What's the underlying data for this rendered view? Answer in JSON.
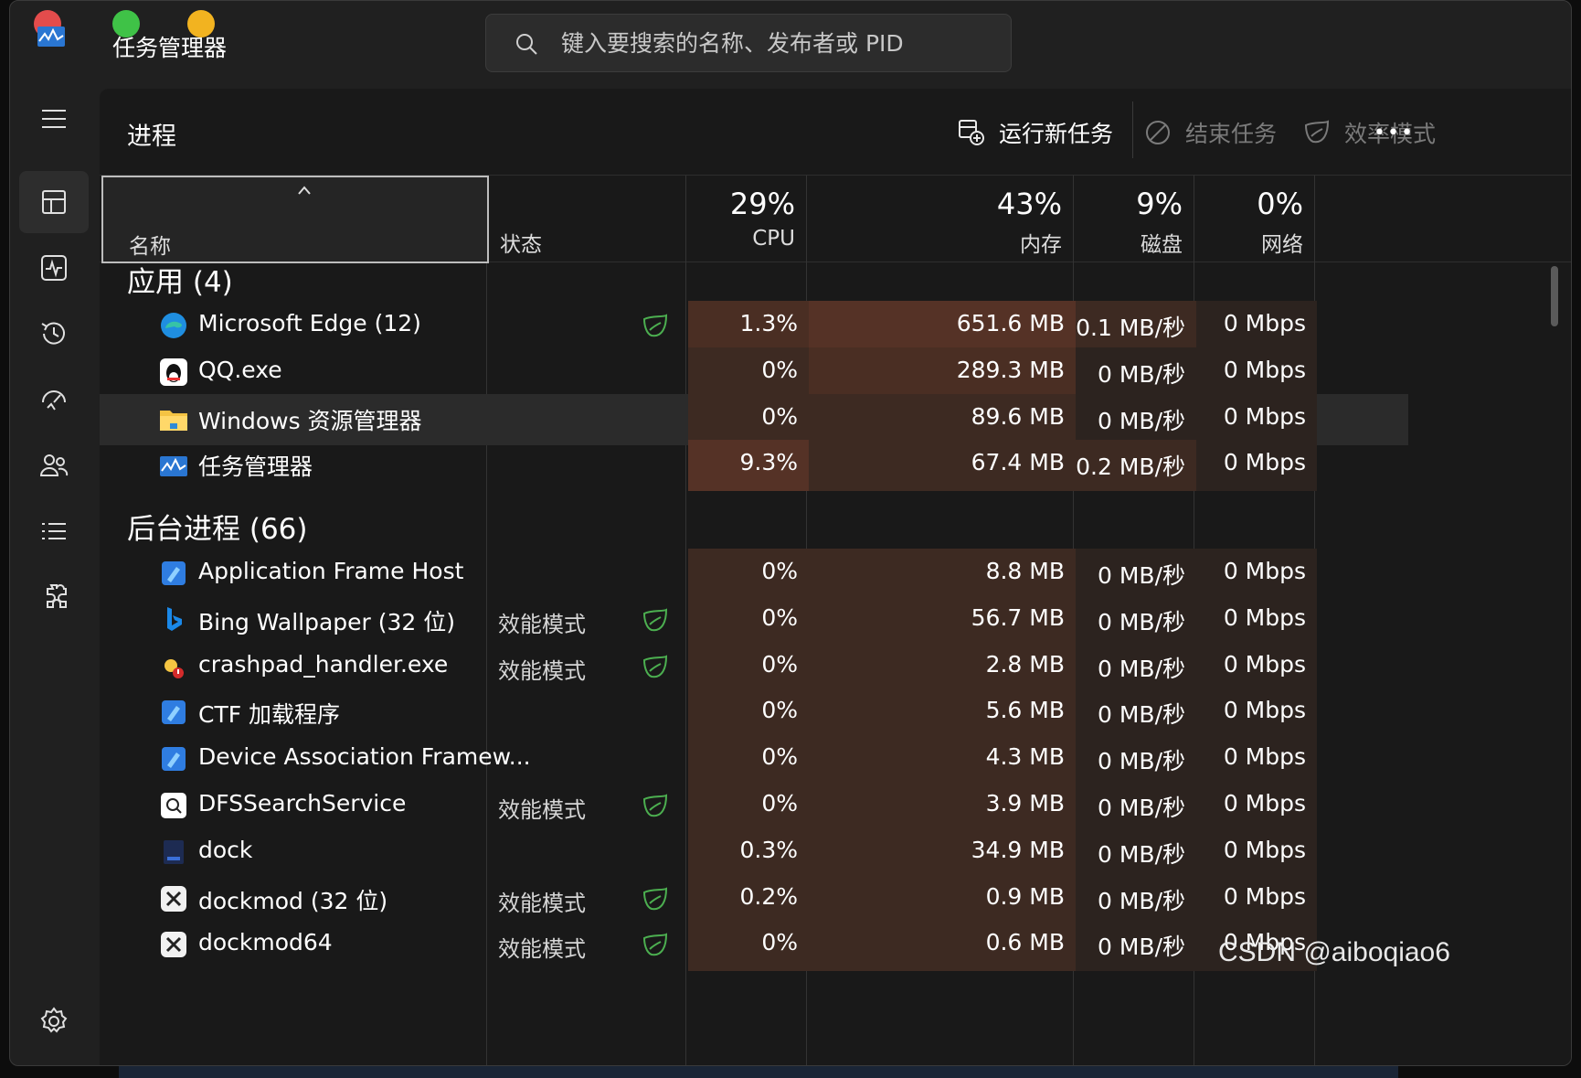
{
  "window": {
    "title": "任务管理器"
  },
  "search": {
    "placeholder": "键入要搜索的名称、发布者或 PID"
  },
  "nav": {
    "items": [
      {
        "name": "menu-icon"
      },
      {
        "name": "processes-icon"
      },
      {
        "name": "performance-icon"
      },
      {
        "name": "app-history-icon"
      },
      {
        "name": "startup-apps-icon"
      },
      {
        "name": "users-icon"
      },
      {
        "name": "details-icon"
      },
      {
        "name": "services-icon"
      },
      {
        "name": "settings-icon"
      }
    ]
  },
  "page": {
    "title": "进程"
  },
  "toolbar": {
    "run_new_task": "运行新任务",
    "end_task": "结束任务",
    "efficiency_mode": "效率模式",
    "more": "•••"
  },
  "columns": {
    "name": "名称",
    "status": "状态",
    "cpu": {
      "pct": "29%",
      "label": "CPU"
    },
    "memory": {
      "pct": "43%",
      "label": "内存"
    },
    "disk": {
      "pct": "9%",
      "label": "磁盘"
    },
    "network": {
      "pct": "0%",
      "label": "网络"
    }
  },
  "groups": {
    "apps": "应用 (4)",
    "background": "后台进程 (66)"
  },
  "apps": [
    {
      "name": "Microsoft Edge (12)",
      "status": "",
      "leaf": true,
      "cpu": "1.3%",
      "mem": "651.6 MB",
      "disk": "0.1 MB/秒",
      "net": "0 Mbps",
      "icon": "edge-icon"
    },
    {
      "name": "QQ.exe",
      "status": "",
      "leaf": false,
      "cpu": "0%",
      "mem": "289.3 MB",
      "disk": "0 MB/秒",
      "net": "0 Mbps",
      "icon": "qq-icon"
    },
    {
      "name": "Windows 资源管理器",
      "status": "",
      "leaf": false,
      "cpu": "0%",
      "mem": "89.6 MB",
      "disk": "0 MB/秒",
      "net": "0 Mbps",
      "icon": "folder-icon"
    },
    {
      "name": "任务管理器",
      "status": "",
      "leaf": false,
      "cpu": "9.3%",
      "mem": "67.4 MB",
      "disk": "0.2 MB/秒",
      "net": "0 Mbps",
      "icon": "task-manager-icon"
    }
  ],
  "background": [
    {
      "name": "Application Frame Host",
      "status": "",
      "leaf": false,
      "cpu": "0%",
      "mem": "8.8 MB",
      "disk": "0 MB/秒",
      "net": "0 Mbps",
      "icon": "app-frame-icon"
    },
    {
      "name": "Bing Wallpaper (32 位)",
      "status": "效能模式",
      "leaf": true,
      "cpu": "0%",
      "mem": "56.7 MB",
      "disk": "0 MB/秒",
      "net": "0 Mbps",
      "icon": "bing-icon"
    },
    {
      "name": "crashpad_handler.exe",
      "status": "效能模式",
      "leaf": true,
      "cpu": "0%",
      "mem": "2.8 MB",
      "disk": "0 MB/秒",
      "net": "0 Mbps",
      "icon": "crashpad-icon"
    },
    {
      "name": "CTF 加载程序",
      "status": "",
      "leaf": false,
      "cpu": "0%",
      "mem": "5.6 MB",
      "disk": "0 MB/秒",
      "net": "0 Mbps",
      "icon": "ctf-icon"
    },
    {
      "name": "Device Association Framew...",
      "status": "",
      "leaf": false,
      "cpu": "0%",
      "mem": "4.3 MB",
      "disk": "0 MB/秒",
      "net": "0 Mbps",
      "icon": "device-assoc-icon"
    },
    {
      "name": "DFSSearchService",
      "status": "效能模式",
      "leaf": true,
      "cpu": "0%",
      "mem": "3.9 MB",
      "disk": "0 MB/秒",
      "net": "0 Mbps",
      "icon": "dfs-search-icon"
    },
    {
      "name": "dock",
      "status": "",
      "leaf": false,
      "cpu": "0.3%",
      "mem": "34.9 MB",
      "disk": "0 MB/秒",
      "net": "0 Mbps",
      "icon": "dock-icon"
    },
    {
      "name": "dockmod (32 位)",
      "status": "效能模式",
      "leaf": true,
      "cpu": "0.2%",
      "mem": "0.9 MB",
      "disk": "0 MB/秒",
      "net": "0 Mbps",
      "icon": "dockmod-icon"
    },
    {
      "name": "dockmod64",
      "status": "效能模式",
      "leaf": true,
      "cpu": "0%",
      "mem": "0.6 MB",
      "disk": "0 MB/秒",
      "net": "0 Mbps",
      "icon": "dockmod64-icon"
    }
  ],
  "watermark": "CSDN @aiboqiao6",
  "colors": {
    "accent": "#e8a36b",
    "leaf": "#4caf50",
    "heat_high": "#553226",
    "heat_low": "#2c231f"
  }
}
